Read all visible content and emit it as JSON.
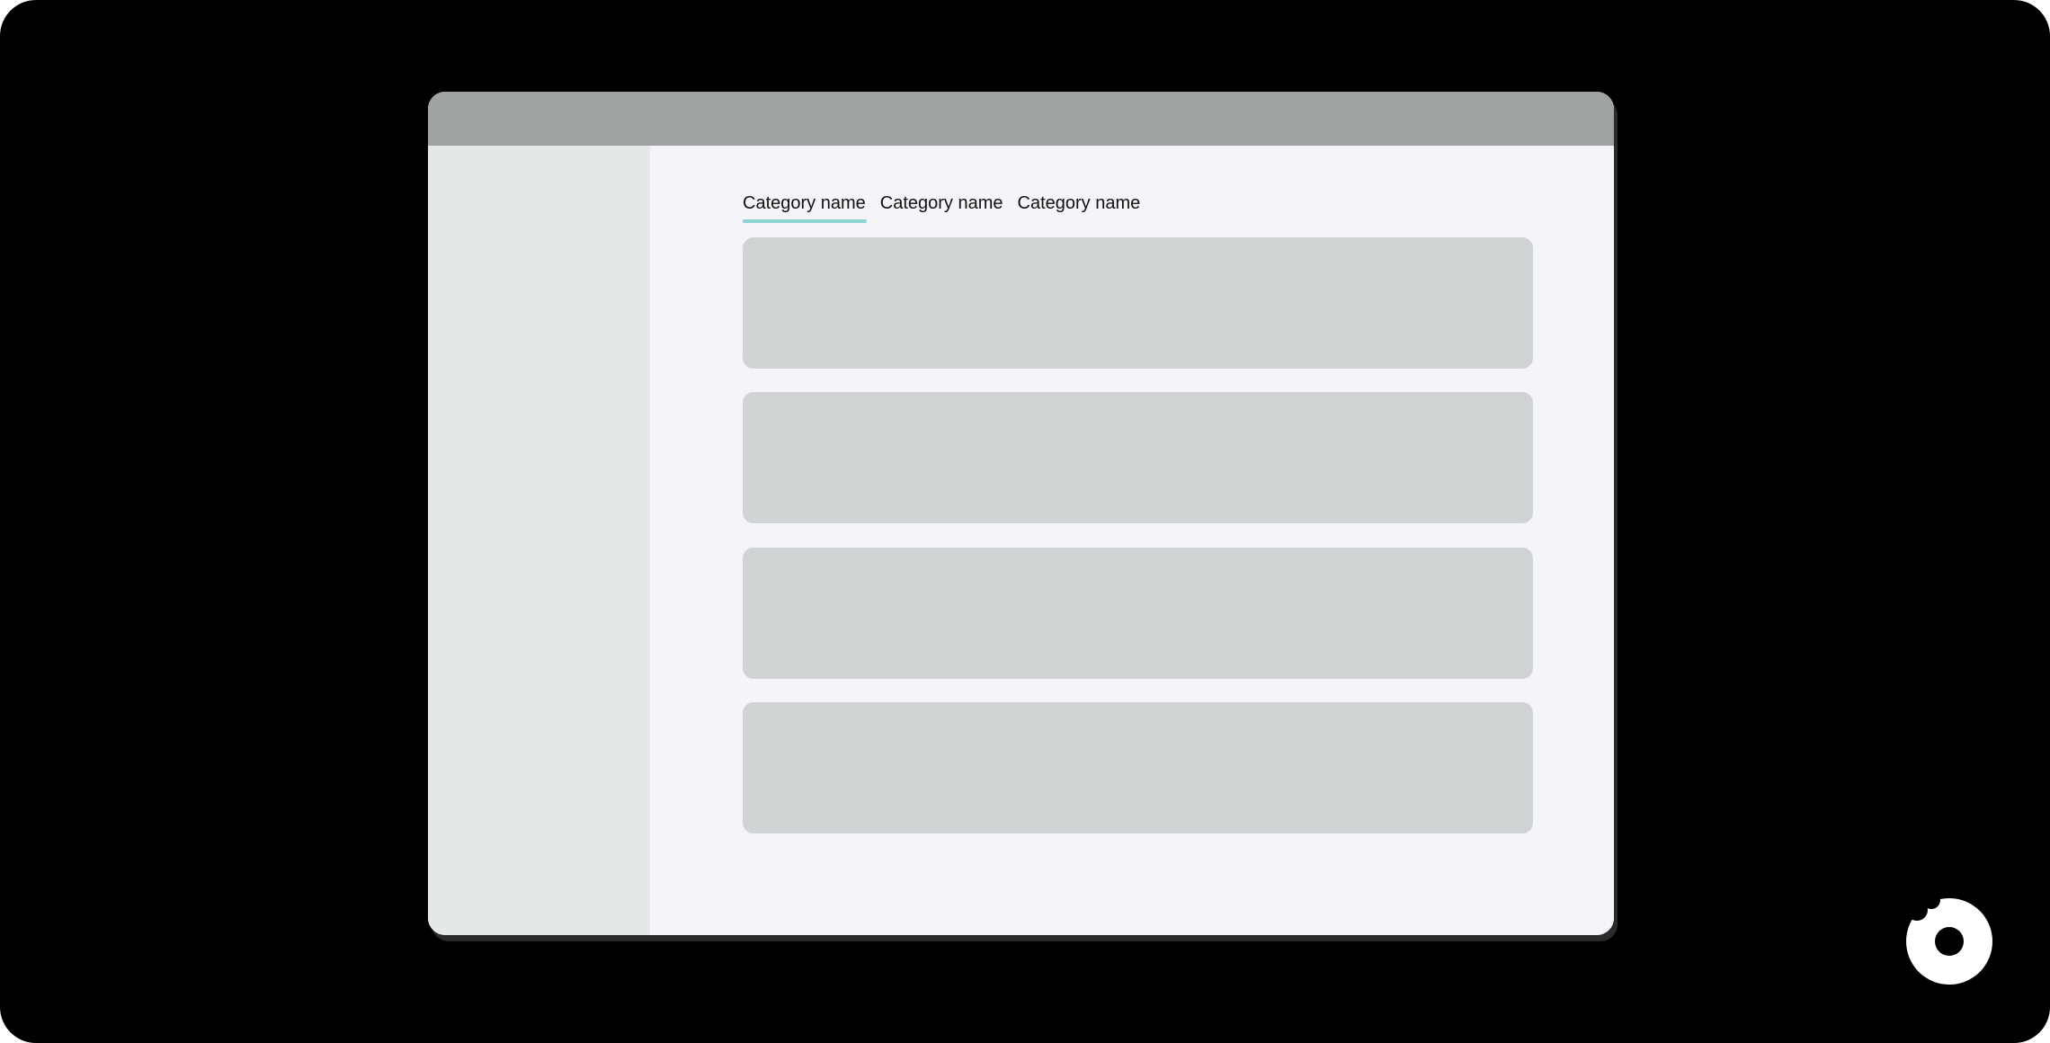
{
  "window": {
    "tabs": [
      {
        "label": "Category name",
        "active": true
      },
      {
        "label": "Category name",
        "active": false
      },
      {
        "label": "Category name",
        "active": false
      }
    ],
    "card_count": 4
  },
  "colors": {
    "background": "#000000",
    "titlebar": "#9ea2a2",
    "sidebar": "#e4e8e9",
    "content": "#f5f5f9",
    "card": "#cfd3d3",
    "accent": "#8fd3d4",
    "logo": "#ffffff"
  },
  "icons": {
    "brand": "brand-logo-icon"
  }
}
